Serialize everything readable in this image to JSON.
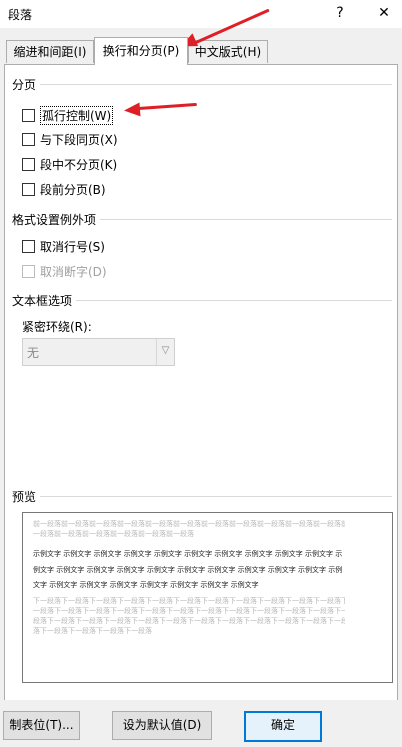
{
  "window": {
    "title": "段落",
    "help_label": "?",
    "close_label": "✕"
  },
  "tabs": [
    {
      "label": "缩进和间距(I)",
      "active": false
    },
    {
      "label": "换行和分页(P)",
      "active": true
    },
    {
      "label": "中文版式(H)",
      "active": false
    }
  ],
  "pagination": {
    "heading": "分页",
    "options": [
      {
        "label": "孤行控制(W)",
        "checked": false,
        "enabled": true
      },
      {
        "label": "与下段同页(X)",
        "checked": false,
        "enabled": true
      },
      {
        "label": "段中不分页(K)",
        "checked": false,
        "enabled": true
      },
      {
        "label": "段前分页(B)",
        "checked": false,
        "enabled": true
      }
    ]
  },
  "format_exceptions": {
    "heading": "格式设置例外项",
    "options": [
      {
        "label": "取消行号(S)",
        "checked": false,
        "enabled": true
      },
      {
        "label": "取消断字(D)",
        "checked": false,
        "enabled": false
      }
    ]
  },
  "textbox": {
    "heading": "文本框选项",
    "wrap_label": "紧密环绕(R):",
    "wrap_value": "无"
  },
  "preview": {
    "heading": "预览",
    "prev_lines": [
      "前一段落前一段落前一段落前一段落前一段落前一段落前一段落前一段落前一段落前一段落前一段落前",
      "一段落前一段落前一段落前一段落前一段落前一段落"
    ],
    "sample_lines": [
      "示例文字 示例文字 示例文字 示例文字 示例文字 示例文字 示例文字 示例文字 示例文字 示例文字 示",
      "例文字 示例文字 示例文字 示例文字 示例文字 示例文字 示例文字 示例文字 示例文字 示例文字 示例",
      "文字 示例文字 示例文字 示例文字 示例文字 示例文字 示例文字 示例文字"
    ],
    "next_lines": [
      "下一段落下一段落下一段落下一段落下一段落下一段落下一段落下一段落下一段落下一段落下一段落下",
      "一段落下一段落下一段落下一段落下一段落下一段落下一段落下一段落下一段落下一段落下一段落下一",
      "段落下一段落下一段落下一段落下一段落下一段落下一段落下一段落下一段落下一段落下一段落下一段",
      "落下一段落下一段落下一段落下一段落"
    ]
  },
  "buttons": {
    "tabs_label": "制表位(T)...",
    "default_label": "设为默认值(D)",
    "ok_label": "确定"
  },
  "colors": {
    "annotation_red": "#df1f26",
    "focus_blue": "#0078d7"
  }
}
